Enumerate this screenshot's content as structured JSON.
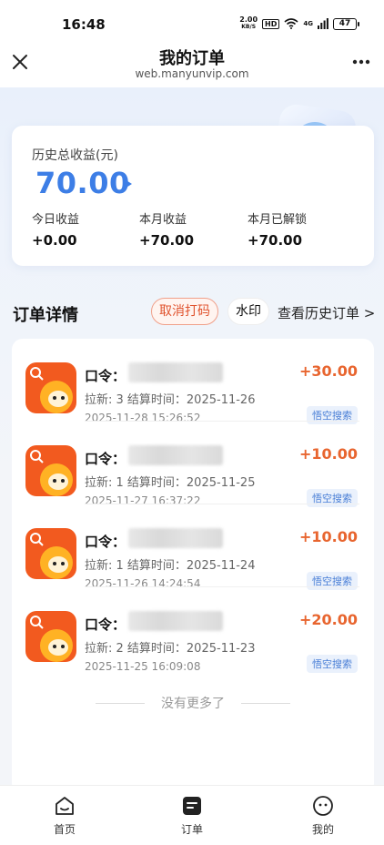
{
  "status": {
    "time": "16:48",
    "net_speed_top": "2.00",
    "net_speed_unit": "KB/S",
    "hd": "HD",
    "signal": "4G",
    "battery": "47"
  },
  "nav": {
    "title": "我的订单",
    "subtitle": "web.manyunvip.com",
    "close_icon": "close-icon",
    "more_icon": "more-icon"
  },
  "earnings": {
    "label": "历史总收益(元)",
    "total": "70.00",
    "today_label": "今日收益",
    "today_value": "+0.00",
    "month_label": "本月收益",
    "month_value": "+70.00",
    "unlocked_label": "本月已解锁",
    "unlocked_value": "+70.00",
    "accent_color": "#3d7ee6"
  },
  "orders": {
    "title": "订单详情",
    "cancel_mask": "取消打码",
    "watermark": "水印",
    "history": "查看历史订单 >",
    "items": [
      {
        "kouling_label": "口令：",
        "meta": "拉新: 3 结算时间：2025-11-26",
        "time": "2025-11-28 15:26:52",
        "amount": "+30.00",
        "tag": "悟空搜索"
      },
      {
        "kouling_label": "口令：",
        "meta": "拉新: 1 结算时间：2025-11-25",
        "time": "2025-11-27 16:37:22",
        "amount": "+10.00",
        "tag": "悟空搜索"
      },
      {
        "kouling_label": "口令：",
        "meta": "拉新: 1 结算时间：2025-11-24",
        "time": "2025-11-26 14:24:54",
        "amount": "+10.00",
        "tag": "悟空搜索"
      },
      {
        "kouling_label": "口令：",
        "meta": "拉新: 2 结算时间：2025-11-23",
        "time": "2025-11-25 16:09:08",
        "amount": "+20.00",
        "tag": "悟空搜索"
      }
    ],
    "end_text": "没有更多了",
    "amount_color": "#e8652f"
  },
  "tabs": [
    {
      "label": "首页",
      "icon": "home-icon"
    },
    {
      "label": "订单",
      "icon": "order-icon"
    },
    {
      "label": "我的",
      "icon": "profile-icon"
    }
  ]
}
